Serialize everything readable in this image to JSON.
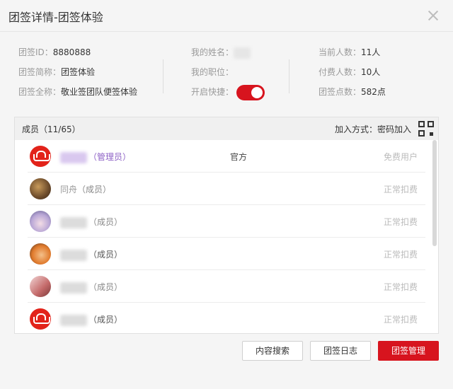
{
  "dialog": {
    "title": "团签详情-团签体验"
  },
  "info": {
    "group_id_label": "团签ID：",
    "group_id_value": "8880888",
    "short_name_label": "团签简称：",
    "short_name_value": "团签体验",
    "full_name_label": "团签全称：",
    "full_name_value": "敬业签团队便签体验",
    "my_name_label": "我的姓名：",
    "my_position_label": "我的职位：",
    "quick_label": "开启快捷：",
    "quick_enabled": true,
    "current_count_label": "当前人数：",
    "current_count_value": "11人",
    "paid_count_label": "付费人数：",
    "paid_count_value": "10人",
    "points_label": "团签点数：",
    "points_value": "582点"
  },
  "members": {
    "title": "成员（11/65）",
    "join_method": "加入方式：密码加入",
    "items": [
      {
        "name": "",
        "role": "（管理员）",
        "official": "官方",
        "status": "免费用户",
        "avatar": "red"
      },
      {
        "name": "同舟",
        "role": "（成员）",
        "official": "",
        "status": "正常扣费",
        "avatar": "brown"
      },
      {
        "name": "",
        "role": "（成员）",
        "official": "",
        "status": "正常扣费",
        "avatar": "anime"
      },
      {
        "name": "",
        "role": "（成员）",
        "official": "",
        "status": "正常扣费",
        "avatar": "orange"
      },
      {
        "name": "",
        "role": "（成员）",
        "official": "",
        "status": "正常扣费",
        "avatar": "pink"
      },
      {
        "name": "",
        "role": "（成员）",
        "official": "",
        "status": "正常扣费",
        "avatar": "red"
      }
    ]
  },
  "buttons": {
    "content_search": "内容搜索",
    "group_log": "团签日志",
    "group_manage": "团签管理"
  },
  "colors": {
    "accent": "#d7141e",
    "admin_role": "#8e62c6"
  }
}
